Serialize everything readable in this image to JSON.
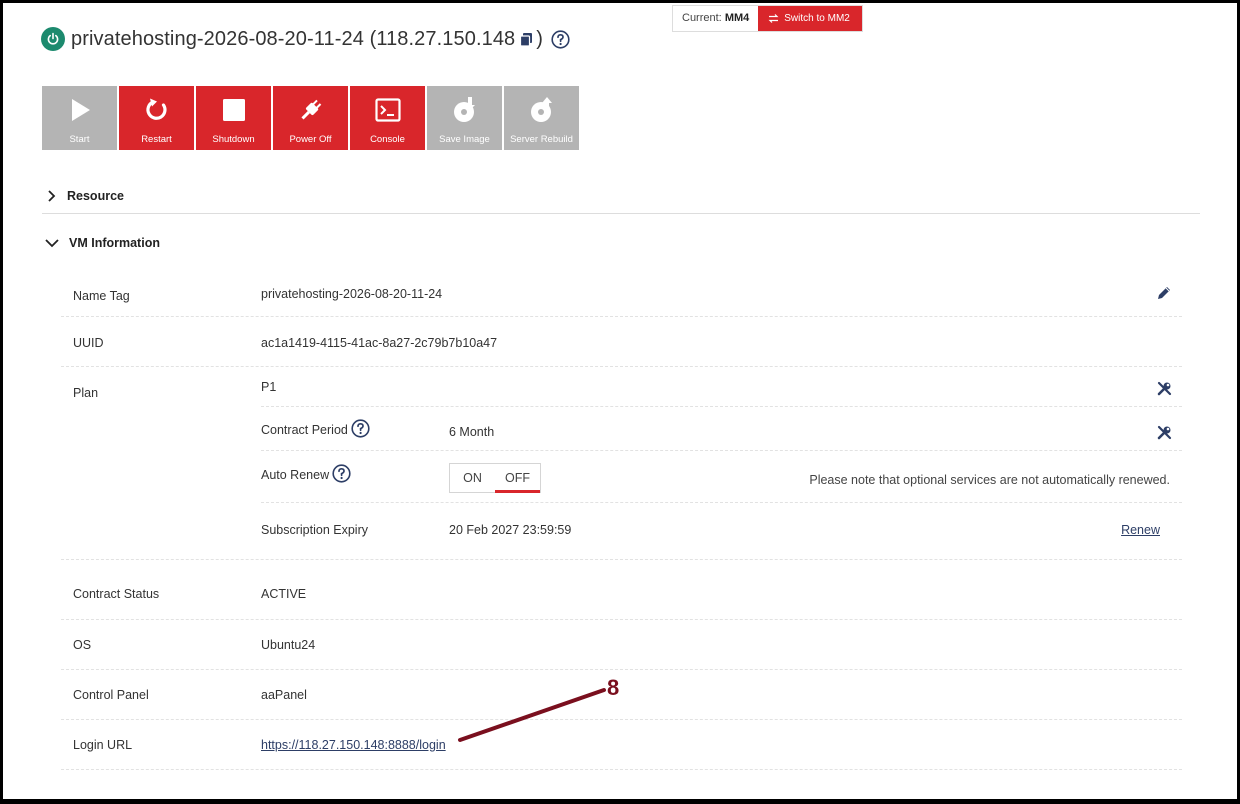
{
  "header": {
    "title": "privatehosting-2026-08-20-11-24 (118.27.150.148",
    "close_paren": ")"
  },
  "switcher": {
    "current_label": "Current:",
    "current_value": "MM4",
    "switch_label": "Switch to MM2"
  },
  "toolbar": {
    "buttons": [
      {
        "label": "Start",
        "state": "disabled",
        "icon": "play-icon"
      },
      {
        "label": "Restart",
        "state": "enabled",
        "icon": "restart-icon"
      },
      {
        "label": "Shutdown",
        "state": "enabled",
        "icon": "stop-icon"
      },
      {
        "label": "Power Off",
        "state": "enabled",
        "icon": "plug-icon"
      },
      {
        "label": "Console",
        "state": "enabled",
        "icon": "terminal-icon"
      },
      {
        "label": "Save Image",
        "state": "disabled",
        "icon": "disc-icon"
      },
      {
        "label": "Server Rebuild",
        "state": "disabled",
        "icon": "disc-arrow-icon"
      }
    ]
  },
  "sections": {
    "resource": "Resource",
    "vm_information": "VM Information"
  },
  "vm": {
    "name_tag": {
      "label": "Name Tag",
      "value": "privatehosting-2026-08-20-11-24"
    },
    "uuid": {
      "label": "UUID",
      "value": "ac1a1419-4115-41ac-8a27-2c79b7b10a47"
    },
    "plan": {
      "label": "Plan",
      "value": "P1",
      "contract_period": {
        "label": "Contract Period",
        "value": "6 Month"
      },
      "auto_renew": {
        "label": "Auto Renew",
        "on": "ON",
        "off": "OFF",
        "selected": "OFF",
        "note": "Please note that optional services are not automatically renewed."
      },
      "subscription_expiry": {
        "label": "Subscription Expiry",
        "value": "20 Feb 2027 23:59:59",
        "action": "Renew"
      }
    },
    "contract_status": {
      "label": "Contract Status",
      "value": "ACTIVE"
    },
    "os": {
      "label": "OS",
      "value": "Ubuntu24"
    },
    "control_panel": {
      "label": "Control Panel",
      "value": "aaPanel"
    },
    "login_url": {
      "label": "Login URL",
      "value": "https://118.27.150.148:8888/login"
    }
  },
  "annotation": {
    "number": "8"
  },
  "colors": {
    "accent_red": "#d9262b",
    "power_green": "#1c8a6e",
    "icon_navy": "#2d3e66",
    "annotation": "#7a0f1e"
  }
}
